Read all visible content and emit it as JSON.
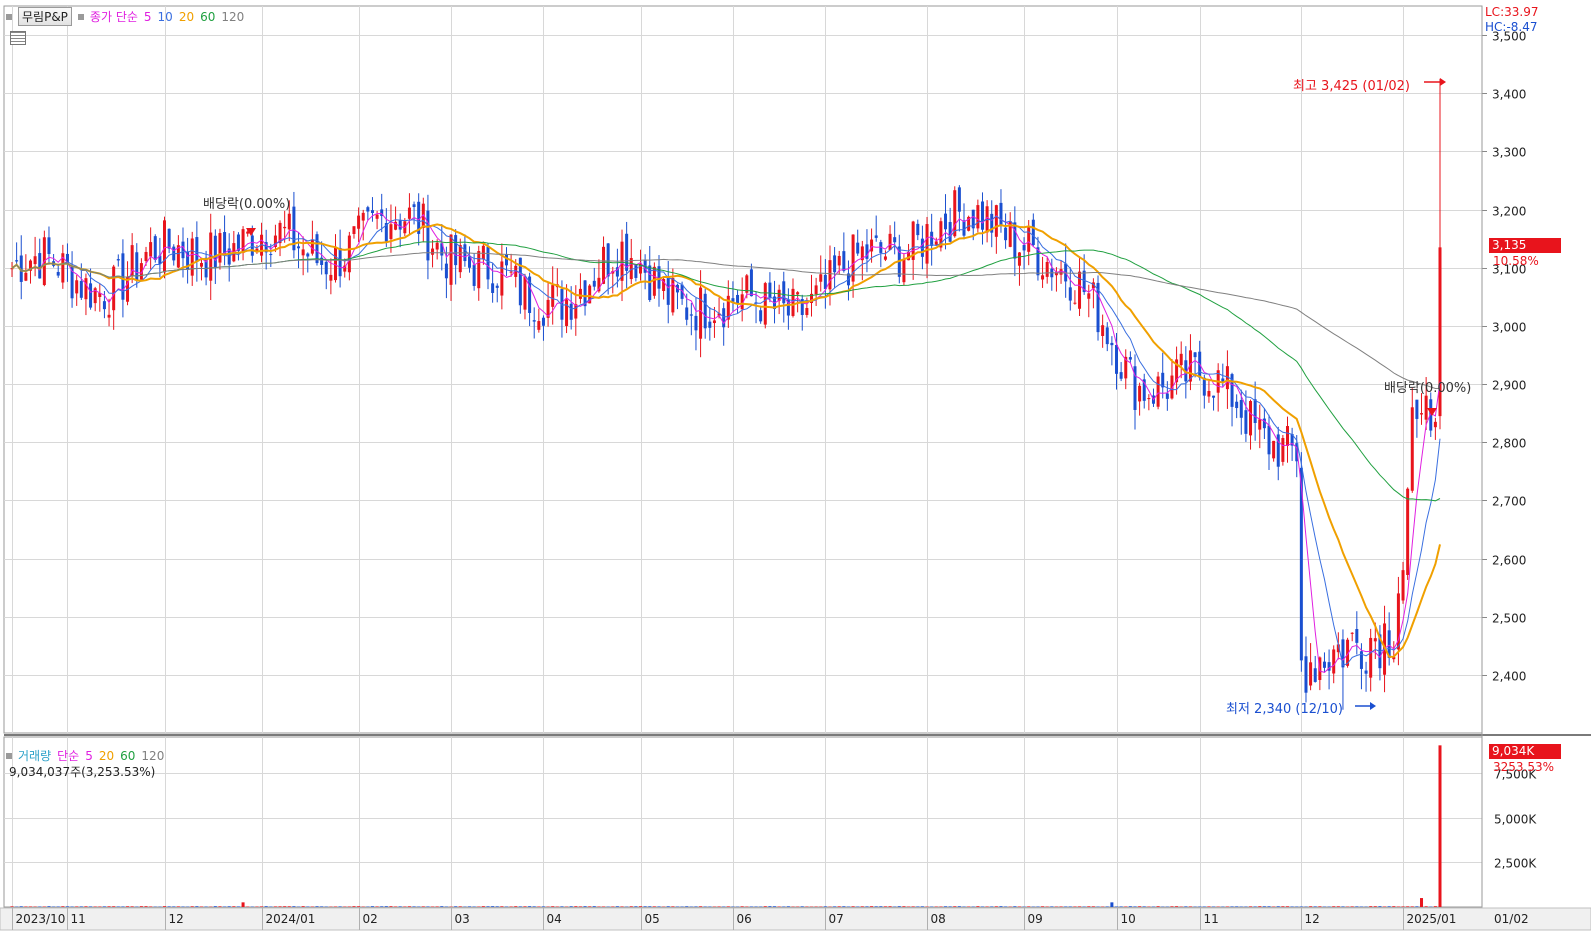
{
  "price_legend": {
    "symbol": "무림P&P",
    "ma_label": "종가 단순",
    "periods": [
      {
        "label": "5",
        "color": "#e020e0"
      },
      {
        "label": "10",
        "color": "#3a6fe0"
      },
      {
        "label": "20",
        "color": "#f0a000"
      },
      {
        "label": "60",
        "color": "#20a040"
      },
      {
        "label": "120",
        "color": "#808080"
      }
    ]
  },
  "volume_legend": {
    "title": "거래량",
    "ma_label": "단순",
    "periods": [
      {
        "label": "5",
        "color": "#e020e0"
      },
      {
        "label": "20",
        "color": "#f0a000"
      },
      {
        "label": "60",
        "color": "#20a040"
      },
      {
        "label": "120",
        "color": "#808080"
      }
    ],
    "value_text": "9,034,037주(3,253.53%)"
  },
  "top_right": {
    "lc": "LC:33.97",
    "hc": "HC:-8.47"
  },
  "annotations": {
    "high": "최고 3,425 (01/02)",
    "low": "최저 2,340 (12/10)",
    "div1": "배당락(0.00%)",
    "div2": "배당락(0.00%)"
  },
  "price_badge": {
    "value": "3,135",
    "pct": "10.58%"
  },
  "volume_badge": {
    "value": "9,034K",
    "pct": "3253.53%"
  },
  "colors": {
    "up": "#e8141c",
    "down": "#1a4fd0",
    "ma5": "#e020e0",
    "ma10": "#3a6fe0",
    "ma20": "#f0a000",
    "ma60": "#20a040",
    "ma120": "#808080"
  },
  "chart_data": [
    {
      "type": "candlestick",
      "y_ticks": [
        "2,400",
        "2,500",
        "2,600",
        "2,700",
        "2,800",
        "2,900",
        "3,000",
        "3,100",
        "3,200",
        "3,300",
        "3,400",
        "3,500"
      ],
      "ylim": [
        2300,
        3550
      ],
      "x_labels": [
        "2023/10",
        "11",
        "12",
        "2024/01",
        "02",
        "03",
        "04",
        "05",
        "06",
        "07",
        "08",
        "09",
        "10",
        "11",
        "12",
        "2025/01",
        "01/02"
      ],
      "monthly_closes": [
        3100,
        3080,
        3150,
        3130,
        3180,
        3040,
        3110,
        3020,
        3060,
        3180,
        3160,
        2920,
        2880,
        2700,
        2550,
        3135
      ],
      "high": 3425,
      "low": 2340,
      "last_close": 3135
    },
    {
      "type": "bar",
      "y_ticks": [
        "2,500K",
        "5,000K",
        "7,500K"
      ],
      "ylim": [
        0,
        9500
      ],
      "last_value": 9034
    }
  ]
}
